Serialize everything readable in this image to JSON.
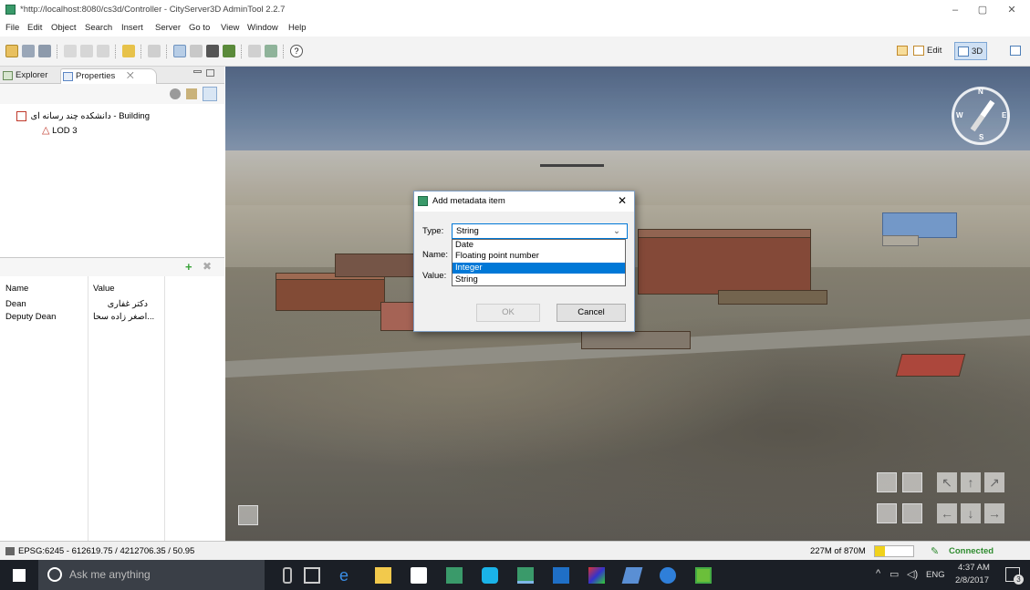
{
  "window": {
    "title": "*http://localhost:8080/cs3d/Controller - CityServer3D AdminTool 2.2.7",
    "controls": [
      "–",
      "▢",
      "✕"
    ]
  },
  "menu": [
    "File",
    "Edit",
    "Object",
    "Search",
    "Insert",
    "Server",
    "Go to",
    "View",
    "Window",
    "Help"
  ],
  "perspectives": {
    "edit_label": "Edit",
    "three_d_label": "3D"
  },
  "tabs": {
    "explorer": "Explorer",
    "properties": "Properties"
  },
  "tree": {
    "building": "دانشکده چند رسانه ای - Building",
    "lod": "LOD 3"
  },
  "properties": {
    "headers": [
      "Name",
      "Value"
    ],
    "rows": [
      {
        "name": "Dean",
        "value": "دکتر غفاری"
      },
      {
        "name": "Deputy Dean",
        "value": "اصغر زاده سحا..."
      }
    ]
  },
  "compass": {
    "n": "N",
    "s": "S",
    "e": "E",
    "w": "W"
  },
  "dialog": {
    "title": "Add metadata item",
    "type_label": "Type:",
    "name_label": "Name:",
    "value_label": "Value:",
    "type_value": "String",
    "options": [
      "Date",
      "Floating point number",
      "Integer",
      "String"
    ],
    "highlighted_option": "Integer",
    "ok_label": "OK",
    "cancel_label": "Cancel"
  },
  "status": {
    "coords": "EPSG:6245 - 612619.75 / 4212706.35 / 50.95",
    "memory": "227M of 870M",
    "memory_fraction": 0.26,
    "connection": "Connected"
  },
  "taskbar": {
    "search_placeholder": "Ask me anything",
    "lang": "ENG",
    "time": "4:37 AM",
    "date": "2/8/2017",
    "notification_count": "3"
  },
  "colors": {
    "accent": "#0078d7",
    "connected": "#2e8b2e",
    "memory_bar": "#f0d21c"
  }
}
